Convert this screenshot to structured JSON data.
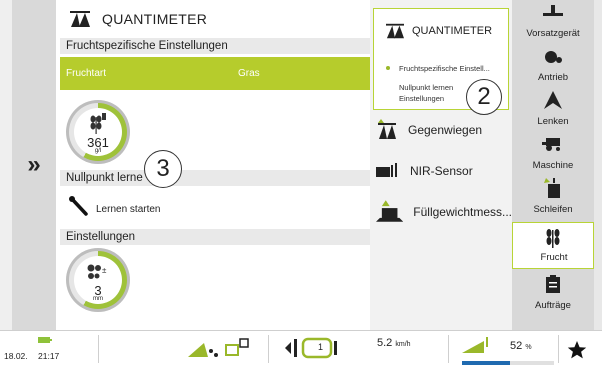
{
  "main": {
    "title": "QUANTIMETER",
    "section_crop": "Fruchtspezifische Einstellungen",
    "crop_label": "Fruchtart",
    "crop_value": "Gras",
    "gauge1_value": "361",
    "gauge1_unit": "g/l",
    "section_zero": "Nullpunkt lerne",
    "learn_start": "Lernen starten",
    "section_settings": "Einstellungen",
    "gauge2_value": "3",
    "gauge2_unit": "mm",
    "badge3": "3"
  },
  "menu": {
    "title": "QUANTIMETER",
    "sub_items": [
      "Fruchtspezifische Einstell...",
      "Nullpunkt lernen",
      "Einstellungen"
    ],
    "badge2": "2",
    "items": [
      "Gegenwiegen",
      "NIR-Sensor",
      "Füllgewichtmess..."
    ]
  },
  "tabs": [
    "Vorsatzgerät",
    "Antrieb",
    "Lenken",
    "Maschine",
    "Schleifen",
    "Frucht",
    "Aufträge"
  ],
  "bottom": {
    "date": "18.02.",
    "time": "21:17",
    "speed": "5.2",
    "speed_unit": "km/h",
    "percent": "52",
    "percent_unit": "%",
    "gear": "1"
  },
  "colors": {
    "accent": "#b6cc2c",
    "green_dark": "#9fc23a",
    "blue": "#1f6ab0"
  }
}
